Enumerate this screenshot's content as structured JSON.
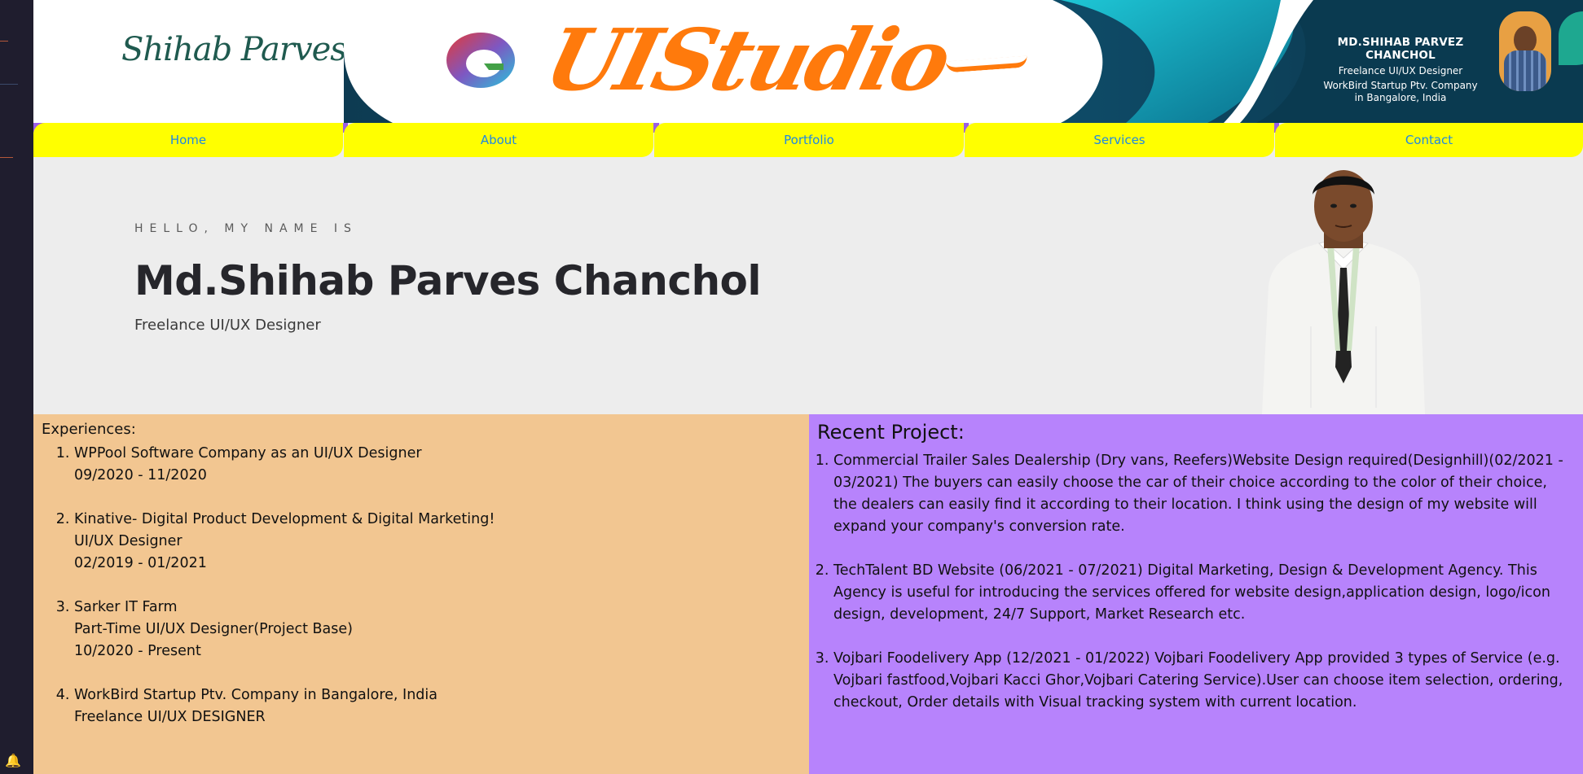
{
  "banner": {
    "signature": "Shihab Parves",
    "logo_text": "UIStudio",
    "card": {
      "name": "MD.SHIHAB PARVEZ CHANCHOL",
      "title": "Freelance UI/UX Designer",
      "company_line1": "WorkBird Startup Ptv. Company",
      "company_line2": "in Bangalore, India"
    }
  },
  "nav": {
    "items": [
      {
        "label": "Home"
      },
      {
        "label": "About"
      },
      {
        "label": "Portfolio"
      },
      {
        "label": "Services"
      },
      {
        "label": "Contact"
      }
    ]
  },
  "hero": {
    "greeting": "HELLO, MY NAME IS",
    "name": "Md.Shihab Parves Chanchol",
    "role": "Freelance UI/UX Designer"
  },
  "experiences": {
    "heading": "Experiences:",
    "items": [
      {
        "lines": [
          "WPPool Software Company as an UI/UX Designer",
          "09/2020 - 11/2020"
        ]
      },
      {
        "lines": [
          "Kinative- Digital Product Development & Digital Marketing!",
          "UI/UX Designer",
          "02/2019 - 01/2021"
        ]
      },
      {
        "lines": [
          "Sarker IT Farm",
          "Part-Time UI/UX Designer(Project Base)",
          "10/2020 - Present"
        ]
      },
      {
        "lines": [
          "WorkBird Startup Ptv. Company in Bangalore, India",
          "Freelance UI/UX DESIGNER"
        ]
      }
    ]
  },
  "projects": {
    "heading": "Recent Project:",
    "items": [
      {
        "text": "Commercial Trailer Sales Dealership (Dry vans, Reefers)Website Design required(Designhill)(02/2021 - 03/2021) The buyers can easily choose the car of their choice according to the color of their choice, the dealers can easily find it according to their location. I think using the design of my website will expand your company's conversion rate."
      },
      {
        "text": "TechTalent BD Website (06/2021 - 07/2021) Digital Marketing, Design & Development Agency. This Agency is useful for introducing the services offered for website design,application design, logo/icon design, development, 24/7 Support, Market Research etc."
      },
      {
        "text": "Vojbari Foodelivery App (12/2021 - 01/2022) Vojbari Foodelivery App provided 3 types of Service (e.g. Vojbari fastfood,Vojbari Kacci Ghor,Vojbari Catering Service).User can choose item selection, ordering, checkout, Order details with Visual tracking system with current location."
      }
    ]
  },
  "colors": {
    "nav_bg": "#ffff00",
    "nav_text": "#1e88e5",
    "experience_bg": "#f2c691",
    "project_bg": "#b783fc",
    "logo_orange": "#ff7a0c"
  }
}
